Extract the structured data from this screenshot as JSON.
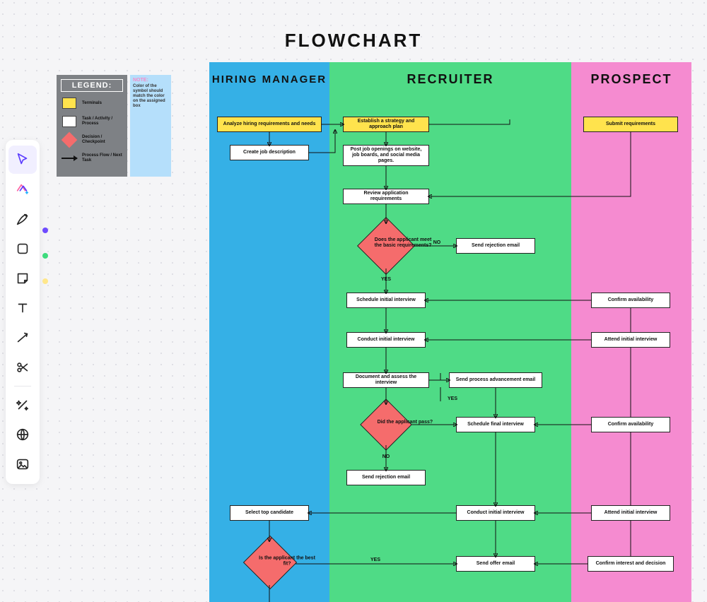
{
  "title": "FLOWCHART",
  "legend": {
    "heading": "LEGEND:",
    "terminals": "Terminals",
    "process": "Task / Activity / Process",
    "decision": "Decision / Checkpoint",
    "flow": "Process Flow / Next Task",
    "note_h": "NOTE:",
    "note_b": "Color of the symbol should match the color on the assigned box"
  },
  "lanes": {
    "hm": "HIRING MANAGER",
    "rc": "RECRUITER",
    "pr": "PROSPECT"
  },
  "nodes": {
    "hm_analyze": "Analyze hiring requirements and needs",
    "hm_jobdesc": "Create job description",
    "hm_select": "Select top candidate",
    "hm_bestfit": "Is the applicant the best fit?",
    "rc_strategy": "Establish a strategy and approach plan",
    "rc_post": "Post job openings on website, job boards, and social media pages.",
    "rc_review": "Review application requirements",
    "rc_basicreq": "Does the applicant meet the basic requirements?",
    "rc_reject1": "Send rejection email",
    "rc_schedule": "Schedule initial interview",
    "rc_conduct1": "Conduct initial interview",
    "rc_assess": "Document and assess the interview",
    "rc_advance": "Send process advancement email",
    "rc_pass": "Did the applicant pass?",
    "rc_final": "Schedule final interview",
    "rc_reject2": "Send rejection email",
    "rc_conduct2": "Conduct initial interview",
    "rc_offer": "Send offer email",
    "pr_submit": "Submit requirements",
    "pr_confirm1": "Confirm availability",
    "pr_attend1": "Attend initial interview",
    "pr_confirm2": "Confirm availability",
    "pr_attend2": "Attend initial interview",
    "pr_decision": "Confirm interest and decision"
  },
  "labels": {
    "yes": "YES",
    "no": "NO"
  },
  "tool_names": {
    "select": "select",
    "ai": "ai",
    "pen": "pen",
    "shape": "shape",
    "sticky": "sticky",
    "text": "text",
    "connector": "connector",
    "cut": "cut",
    "magic": "magic",
    "web": "web",
    "image": "image"
  }
}
